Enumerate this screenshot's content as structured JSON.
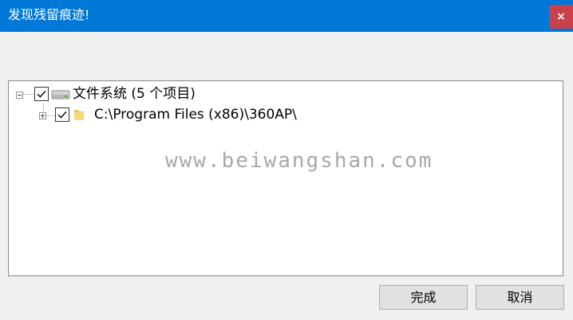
{
  "window": {
    "title": "发现残留痕迹!",
    "close_symbol": "×",
    "titlebar_color": "#0078d7",
    "close_color": "#c8414b"
  },
  "tree": {
    "root": {
      "label": "文件系统 (5 个项目)",
      "checked": true,
      "expanded": true,
      "icon": "drive-icon"
    },
    "children": [
      {
        "label": "C:\\Program Files (x86)\\360AP\\",
        "checked": true,
        "expanded": false,
        "icon": "folder-icon"
      }
    ]
  },
  "watermark": "www.beiwangshan.com",
  "buttons": {
    "finish": "完成",
    "cancel": "取消"
  }
}
